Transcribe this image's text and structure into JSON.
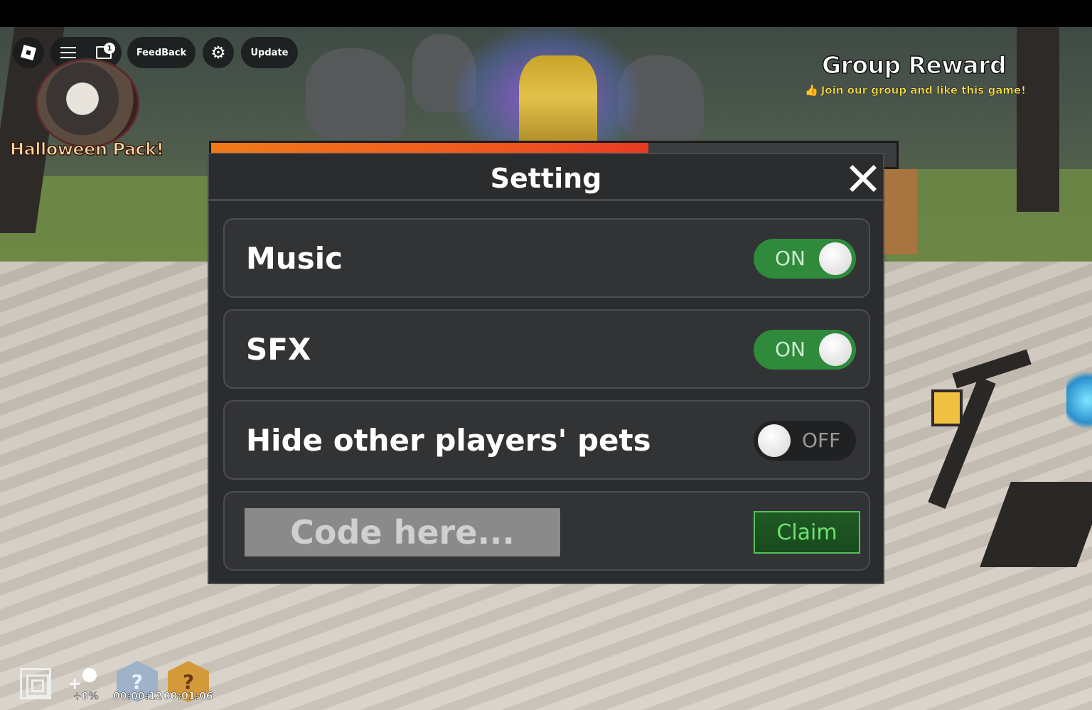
{
  "hud": {
    "feedback_label": "FeedBack",
    "update_label": "Update",
    "chat_badge": "1"
  },
  "promo": {
    "halloween_label": "Halloween Pack!",
    "group_title": "Group Reward",
    "group_sub": "Join our group and like this game!"
  },
  "settings": {
    "title": "Setting",
    "rows": [
      {
        "label": "Music",
        "state": "ON"
      },
      {
        "label": "SFX",
        "state": "ON"
      },
      {
        "label": "Hide other players' pets",
        "state": "OFF"
      }
    ],
    "code_placeholder": "Code here...",
    "claim_label": "Claim"
  },
  "bottom": {
    "bonus_pct": "+0%",
    "timer1": "00:00:12",
    "timer2": "00:01:06",
    "hex1_glyph": "?",
    "hex2_glyph": "?"
  },
  "colors": {
    "toggle_on": "#2f8a3c",
    "toggle_off": "#202123",
    "claim_text": "#6fe06f",
    "panel_bg": "#2b2c2e"
  }
}
